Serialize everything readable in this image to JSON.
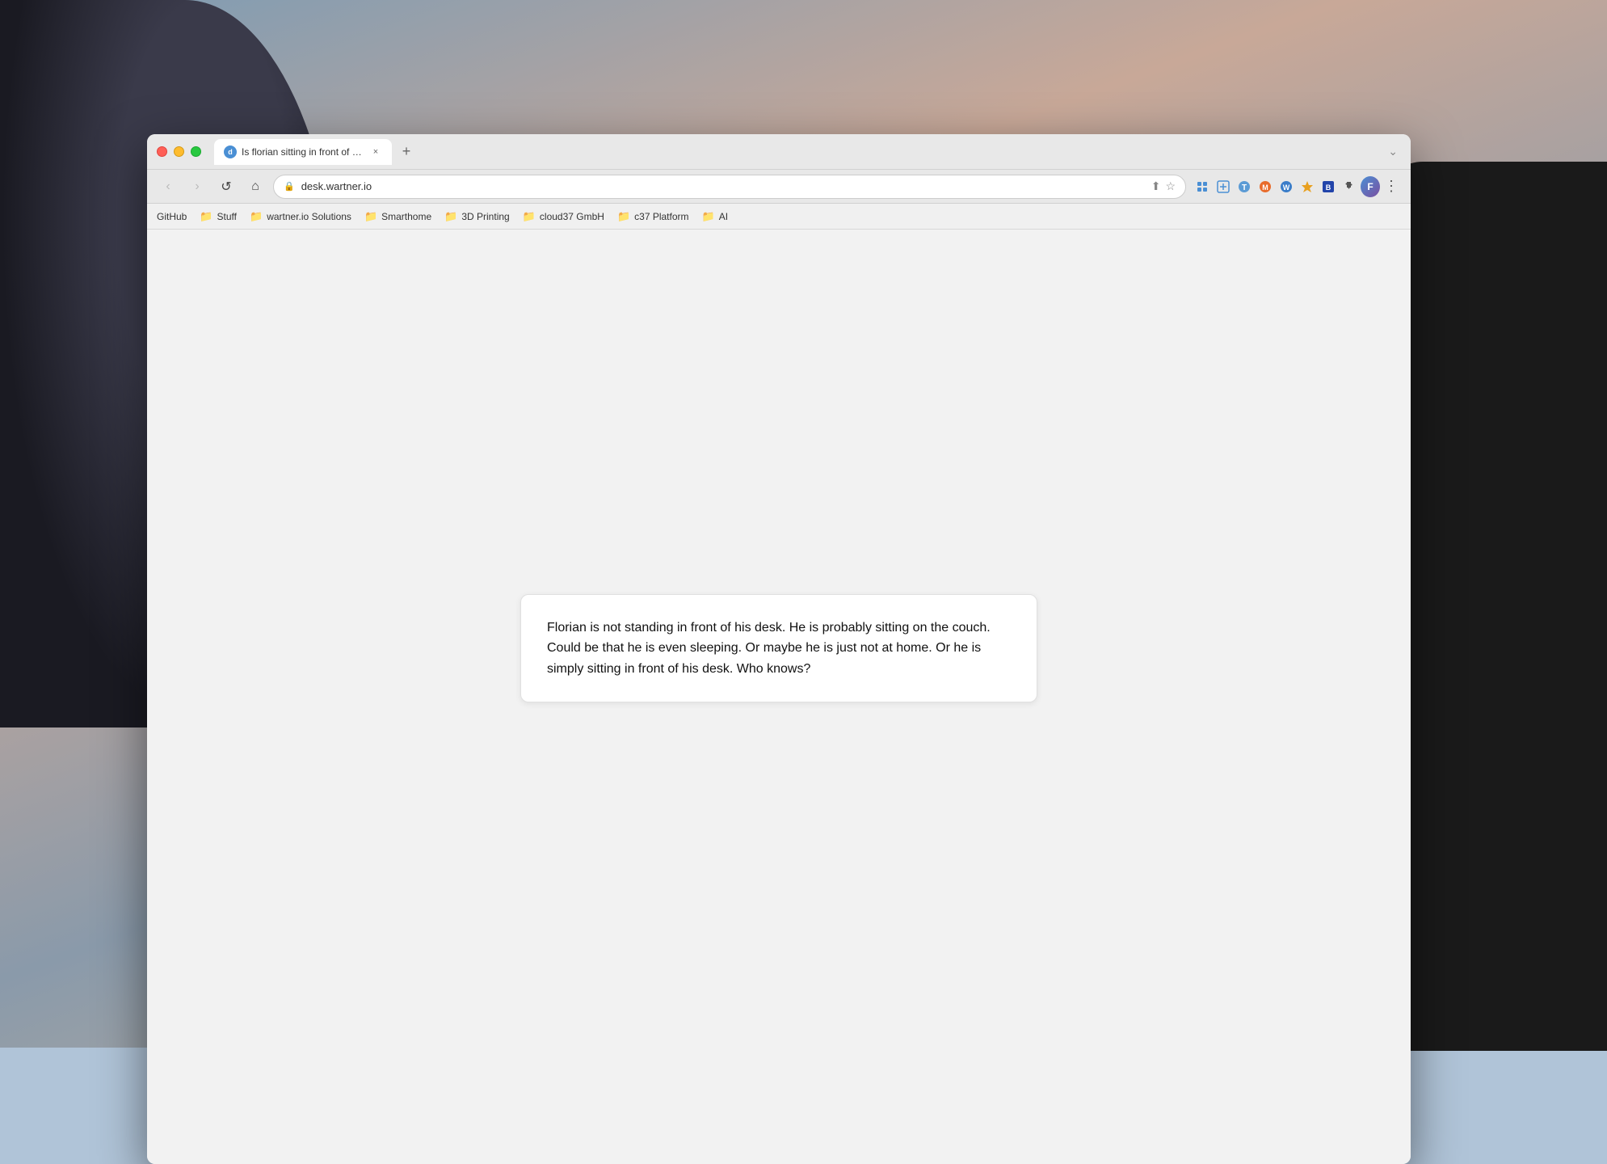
{
  "background": {
    "description": "Outdoor photo background with people"
  },
  "browser": {
    "window_title": "Chrome Browser",
    "tab": {
      "favicon_letter": "d",
      "title": "Is florian sitting in front of his...",
      "close_label": "×"
    },
    "new_tab_label": "+",
    "window_chevron": "⌄",
    "nav": {
      "back_label": "‹",
      "forward_label": "›",
      "reload_label": "↺",
      "home_label": "⌂"
    },
    "address_bar": {
      "lock_icon": "🔒",
      "url": "desk.wartner.io",
      "upload_icon": "⬆",
      "star_icon": "☆"
    },
    "toolbar": {
      "extensions_icon": "⊞",
      "more_icon": "⋮"
    },
    "ext_icons": [
      "⬡",
      "⊡",
      "⬒",
      "⬕",
      "⬗",
      "★",
      "⬙"
    ],
    "bookmarks": [
      {
        "type": "text",
        "label": "GitHub"
      },
      {
        "type": "folder",
        "label": "Stuff"
      },
      {
        "type": "folder",
        "label": "wartner.io Solutions"
      },
      {
        "type": "folder",
        "label": "Smarthome"
      },
      {
        "type": "folder",
        "label": "3D Printing"
      },
      {
        "type": "folder",
        "label": "cloud37 GmbH"
      },
      {
        "type": "folder",
        "label": "c37 Platform"
      },
      {
        "type": "folder",
        "label": "AI"
      }
    ],
    "page": {
      "answer_text": "Florian is not standing in front of his desk. He is probably sitting on the couch. Could be that he is even sleeping. Or maybe he is just not at home. Or he is simply sitting in front of his desk. Who knows?"
    }
  }
}
